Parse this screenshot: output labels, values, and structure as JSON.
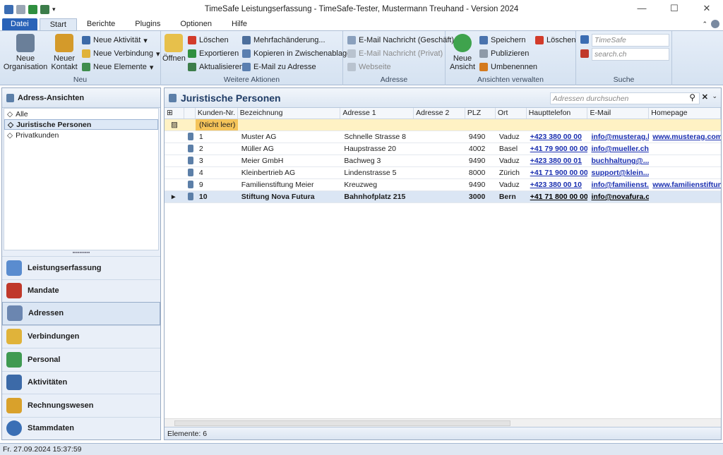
{
  "window": {
    "title": "TimeSafe Leistungserfassung - TimeSafe-Tester, Mustermann Treuhand - Version 2024"
  },
  "tabs": [
    "Datei",
    "Start",
    "Berichte",
    "Plugins",
    "Optionen",
    "Hilfe"
  ],
  "ribbon": {
    "neu": {
      "label": "Neu",
      "organisation": "Neue\nOrganisation",
      "kontakt": "Neuer\nKontakt",
      "aktivitaet": "Neue Aktivität",
      "verbindung": "Neue Verbindung",
      "elemente": "Neue Elemente"
    },
    "weitere": {
      "label": "Weitere Aktionen",
      "oeffnen": "Öffnen",
      "loeschen": "Löschen",
      "exportieren": "Exportieren",
      "aktualisieren": "Aktualisieren",
      "mehrfach": "Mehrfachänderung...",
      "kopieren": "Kopieren in Zwischenablage",
      "email": "E-Mail zu Adresse"
    },
    "adresse": {
      "label": "Adresse",
      "email_g": "E-Mail Nachricht (Geschäft)",
      "email_p": "E-Mail Nachricht (Privat)",
      "webseite": "Webseite"
    },
    "ansichten": {
      "label": "Ansichten verwalten",
      "neue": "Neue\nAnsicht",
      "speichern": "Speichern",
      "publizieren": "Publizieren",
      "umbenennen": "Umbenennen",
      "loeschen": "Löschen"
    },
    "suche": {
      "label": "Suche",
      "ph1": "TimeSafe",
      "ph2": "search.ch"
    }
  },
  "left": {
    "title": "Adress-Ansichten",
    "items": [
      "Alle",
      "Juristische Personen",
      "Privatkunden"
    ],
    "nav": [
      "Leistungserfassung",
      "Mandate",
      "Adressen",
      "Verbindungen",
      "Personal",
      "Aktivitäten",
      "Rechnungswesen",
      "Stammdaten"
    ]
  },
  "main": {
    "title": "Juristische Personen",
    "search_placeholder": "Adressen durchsuchen",
    "footer": "Elemente: 6",
    "columns": [
      "Kunden-Nr. Δ",
      "Bezeichnung",
      "Adresse 1",
      "Adresse 2",
      "PLZ",
      "Ort",
      "Haupttelefon",
      "E-Mail",
      "Homepage"
    ],
    "filter": "(Nicht leer)",
    "rows": [
      {
        "nr": "1",
        "name": "Muster AG",
        "adr1": "Schnelle Strasse 8",
        "adr2": "",
        "plz": "9490",
        "ort": "Vaduz",
        "tel": "+423 380 00 00",
        "mail": "info@musterag.li",
        "web": "www.musterag.com"
      },
      {
        "nr": "2",
        "name": "Müller AG",
        "adr1": "Haupstrasse 20",
        "adr2": "",
        "plz": "4002",
        "ort": "Basel",
        "tel": "+41 79 900 00 00",
        "mail": "info@mueller.ch",
        "web": ""
      },
      {
        "nr": "3",
        "name": "Meier GmbH",
        "adr1": "Bachweg 3",
        "adr2": "",
        "plz": "9490",
        "ort": "Vaduz",
        "tel": "+423 380 00 01",
        "mail": "buchhaltung@...",
        "web": ""
      },
      {
        "nr": "4",
        "name": "Kleinbertrieb AG",
        "adr1": "Lindenstrasse 5",
        "adr2": "",
        "plz": "8000",
        "ort": "Zürich",
        "tel": "+41 71 900 00 00",
        "mail": "support@klein....",
        "web": ""
      },
      {
        "nr": "9",
        "name": "Familienstiftung Meier",
        "adr1": "Kreuzweg",
        "adr2": "",
        "plz": "9490",
        "ort": "Vaduz",
        "tel": "+423 380 00 10",
        "mail": "info@familienst...",
        "web": "www.familienstiftun..."
      },
      {
        "nr": "10",
        "name": "Stiftung Nova Futura",
        "adr1": "Bahnhofplatz 215",
        "adr2": "",
        "plz": "3000",
        "ort": "Bern",
        "tel": "+41 71 800 00 00",
        "mail": "info@novafura.ch",
        "web": ""
      }
    ]
  },
  "status": "Fr. 27.09.2024 15:37:59"
}
